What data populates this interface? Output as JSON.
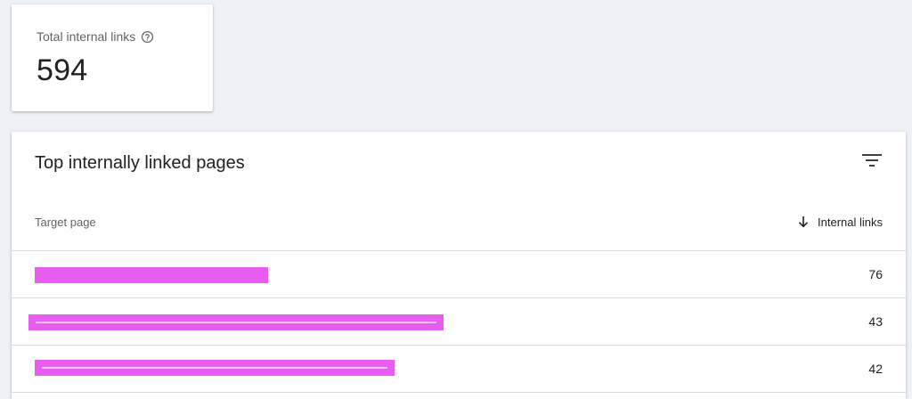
{
  "summary": {
    "label": "Total internal links",
    "value": "594",
    "help_icon": "help-circle-icon"
  },
  "table_card": {
    "title": "Top internally linked pages",
    "filter_icon": "filter-list-icon",
    "columns": {
      "target_page": "Target page",
      "internal_links": "Internal links",
      "sort_icon": "arrow-down-icon"
    },
    "rows": [
      {
        "target_page": "",
        "internal_links": "76"
      },
      {
        "target_page": "",
        "internal_links": "43"
      },
      {
        "target_page": "",
        "internal_links": "42"
      }
    ]
  },
  "colors": {
    "background": "#eef1f7",
    "card": "#ffffff",
    "redaction": "#e85cf0",
    "divider": "#dadce0"
  }
}
